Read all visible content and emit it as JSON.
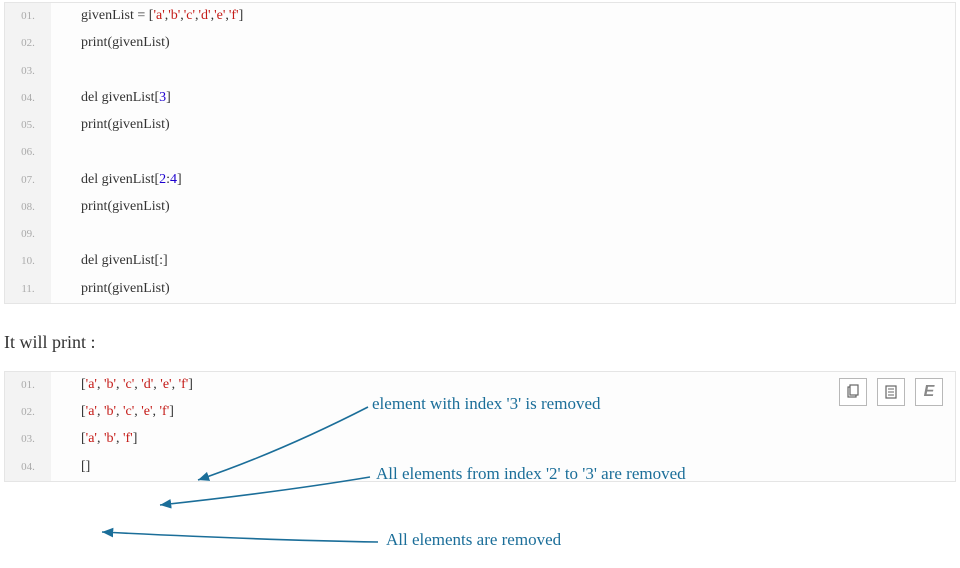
{
  "code": {
    "lines": [
      {
        "n": "01.",
        "pre": "givenList = [",
        "lits": [
          "'a'",
          "'b'",
          "'c'",
          "'d'",
          "'e'",
          "'f'"
        ],
        "post": "]"
      },
      {
        "n": "02.",
        "plain": "print(givenList)"
      },
      {
        "n": "03.",
        "plain": ""
      },
      {
        "n": "04.",
        "del_pre": "del givenList[",
        "nums": [
          "3"
        ],
        "del_post": "]"
      },
      {
        "n": "05.",
        "plain": "print(givenList)"
      },
      {
        "n": "06.",
        "plain": ""
      },
      {
        "n": "07.",
        "del_pre": "del givenList[",
        "nums": [
          "2",
          ":",
          "4"
        ],
        "del_post": "]"
      },
      {
        "n": "08.",
        "plain": "print(givenList)"
      },
      {
        "n": "09.",
        "plain": ""
      },
      {
        "n": "10.",
        "del_pre": "del givenList[:",
        "nums": [],
        "del_post": "]"
      },
      {
        "n": "11.",
        "plain": "print(givenList)"
      }
    ]
  },
  "intro_text": "It will print :",
  "output": {
    "lines": [
      {
        "n": "01.",
        "items": [
          "'a'",
          "'b'",
          "'c'",
          "'d'",
          "'e'",
          "'f'"
        ]
      },
      {
        "n": "02.",
        "items": [
          "'a'",
          "'b'",
          "'c'",
          "'e'",
          "'f'"
        ]
      },
      {
        "n": "03.",
        "items": [
          "'a'",
          "'b'",
          "'f'"
        ]
      },
      {
        "n": "04.",
        "items": []
      }
    ]
  },
  "annotations": {
    "a1": "element with index '3' is removed",
    "a2": "All elements from index '2' to '3' are removed",
    "a3": "All elements are removed"
  },
  "toolbar": {
    "btn1": "⎘",
    "btn2": "☰",
    "btn3": "E"
  }
}
